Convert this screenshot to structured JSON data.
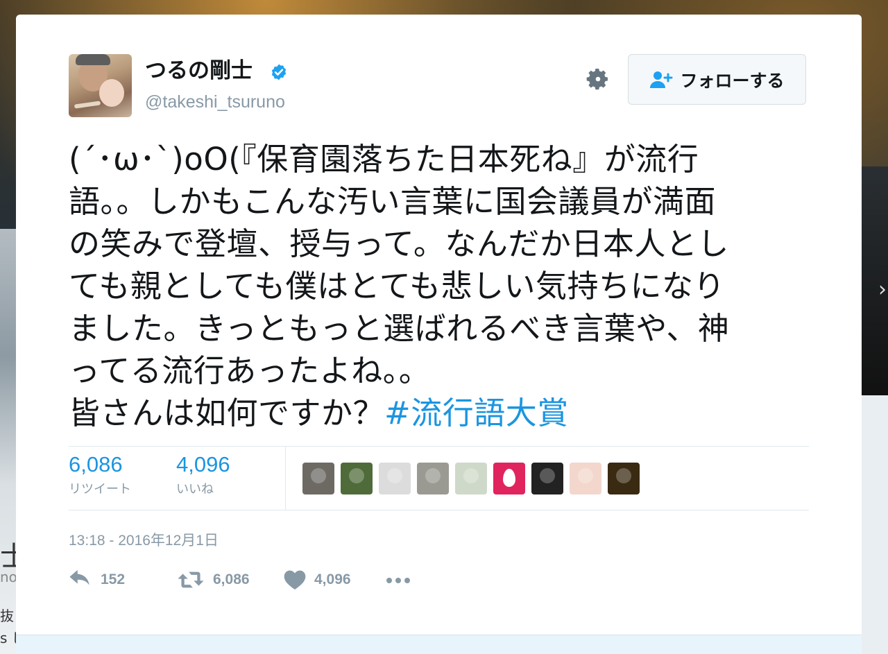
{
  "user": {
    "name": "つるの剛士",
    "handle": "@takeshi_tsuruno",
    "verified": true,
    "avatar_alt": "profile photo"
  },
  "follow_button": {
    "label": "フォローする"
  },
  "tweet": {
    "text": "(´･ω･`)oO(『保育園落ちた日本死ね』が流行\n語。。しかもこんな汚い言葉に国会議員が満面\nの笑みで登壇、授与って。なんだか日本人とし\nても親としても僕はとても悲しい気持ちになり\nました。きっともっと選ばれるべき言葉や、神\nってる流行あったよね。。\n皆さんは如何ですか？",
    "hashtag": "#流行語大賞"
  },
  "stats": {
    "retweets": {
      "value": "6,086",
      "label": "リツイート"
    },
    "likes": {
      "value": "4,096",
      "label": "いいね"
    }
  },
  "likers": [
    {
      "icon": "liker-photo-icon",
      "color": "#6d6a64"
    },
    {
      "icon": "liker-waterfall-icon",
      "color": "#4f6b3a"
    },
    {
      "icon": "liker-drawing-icon",
      "color": "#dcdcdc"
    },
    {
      "icon": "liker-cat-icon",
      "color": "#9a9a92"
    },
    {
      "icon": "liker-person-icon",
      "color": "#cfd9c9"
    },
    {
      "icon": "liker-egg-icon",
      "color": "#e0245e"
    },
    {
      "icon": "liker-anime-icon",
      "color": "#222222"
    },
    {
      "icon": "liker-girl-icon",
      "color": "#f3d7cd"
    },
    {
      "icon": "liker-dark-icon",
      "color": "#3a2a12"
    }
  ],
  "timestamp": "13:18 - 2016年12月1日",
  "actions": {
    "reply": "152",
    "retweet": "6,086",
    "like": "4,096"
  },
  "background": {
    "left_chars": [
      "士",
      "no",
      "抜",
      "s じ"
    ]
  },
  "colors": {
    "link": "#1b95e0",
    "text": "#14171a",
    "muted": "#8899a6",
    "verified": "#1da1f2",
    "action_icon": "#8899a6"
  }
}
